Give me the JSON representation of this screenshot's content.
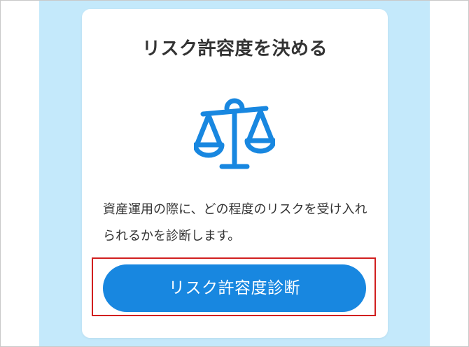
{
  "card": {
    "title": "リスク許容度を決める",
    "icon": "balance-scale-icon",
    "description": "資産運用の際に、どの程度のリスクを受け入れられるかを診断します。",
    "button_label": "リスク許容度診断"
  },
  "colors": {
    "background_band": "#c4e9fb",
    "accent": "#1887e0",
    "highlight_border": "#d11f1f",
    "text": "#333333"
  }
}
